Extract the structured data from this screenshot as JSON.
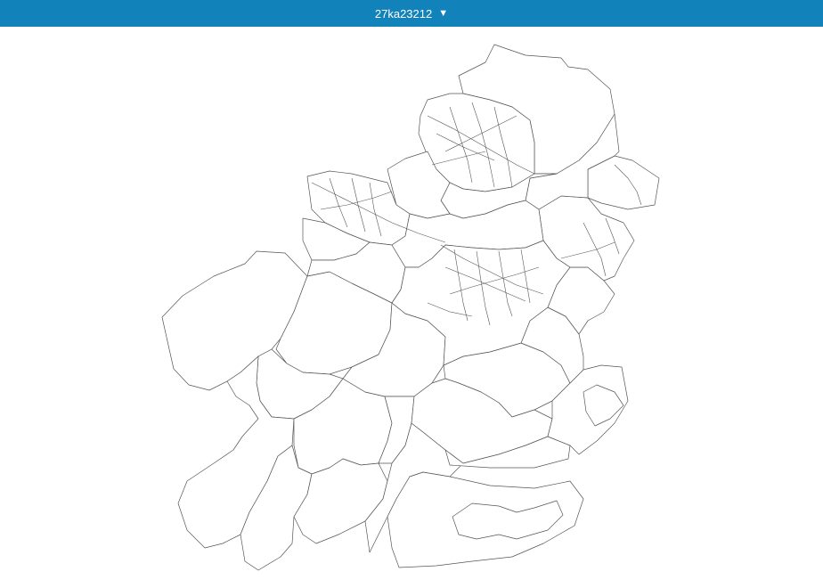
{
  "header": {
    "selector_label": "27ka23212",
    "caret_icon": "triangle-down-icon",
    "background_color": "#1282ba",
    "text_color": "#ffffff"
  },
  "map": {
    "boundary_color": "#555555",
    "fill_color": "#ffffff"
  }
}
